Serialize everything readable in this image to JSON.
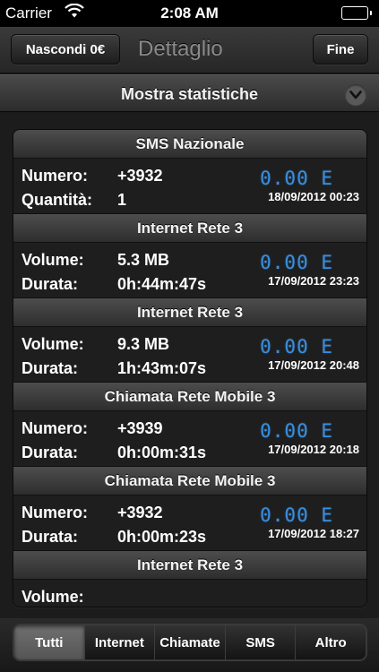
{
  "status_bar": {
    "carrier": "Carrier",
    "time": "2:08 AM"
  },
  "nav": {
    "left_button": "Nascondi 0€",
    "title": "Dettaglio",
    "right_button": "Fine"
  },
  "stats_header": {
    "label": "Mostra statistiche"
  },
  "entries": [
    {
      "header": "SMS Nazionale",
      "k1": "Numero:",
      "v1": "+3932",
      "k2": "Quantità:",
      "v2": "1",
      "cost": "0.00 E",
      "date": "18/09/2012 00:23"
    },
    {
      "header": "Internet Rete 3",
      "k1": "Volume:",
      "v1": "5.3 MB",
      "k2": "Durata:",
      "v2": "0h:44m:47s",
      "cost": "0.00 E",
      "date": "17/09/2012 23:23"
    },
    {
      "header": "Internet Rete 3",
      "k1": "Volume:",
      "v1": "9.3 MB",
      "k2": "Durata:",
      "v2": "1h:43m:07s",
      "cost": "0.00 E",
      "date": "17/09/2012 20:48"
    },
    {
      "header": "Chiamata Rete Mobile 3",
      "k1": "Numero:",
      "v1": "+3939",
      "k2": "Durata:",
      "v2": "0h:00m:31s",
      "cost": "0.00 E",
      "date": "17/09/2012 20:18"
    },
    {
      "header": "Chiamata Rete Mobile 3",
      "k1": "Numero:",
      "v1": "+3932",
      "k2": "Durata:",
      "v2": "0h:00m:23s",
      "cost": "0.00 E",
      "date": "17/09/2012 18:27"
    },
    {
      "header": "Internet Rete 3",
      "k1": "Volume:",
      "v1": "",
      "k2": "",
      "v2": "",
      "cost": "",
      "date": ""
    }
  ],
  "tabs": {
    "selected": "Tutti",
    "items": [
      "Tutti",
      "Internet",
      "Chiamate",
      "SMS",
      "Altro"
    ]
  }
}
